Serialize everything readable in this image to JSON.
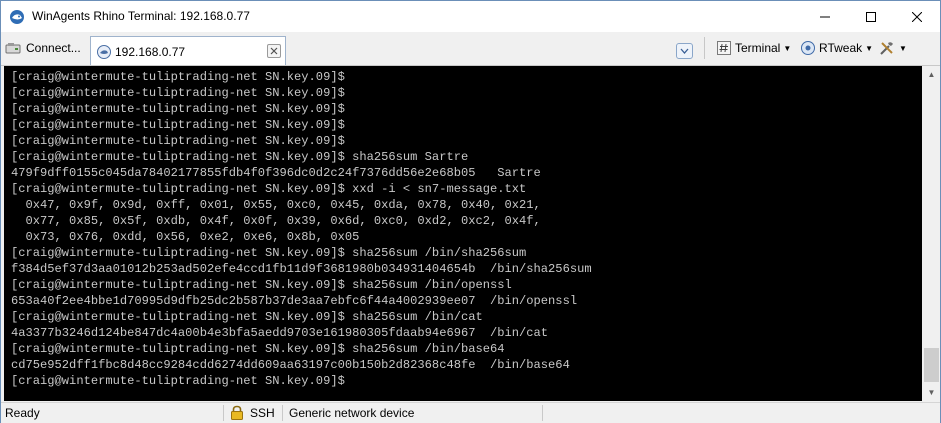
{
  "window": {
    "title": "WinAgents Rhino Terminal: 192.168.0.77",
    "app_icon": "rhino-terminal-icon",
    "controls": [
      "minimize-icon",
      "maximize-icon",
      "close-icon"
    ]
  },
  "toolbar": {
    "connect_label": "Connect...",
    "tab_label": "192.168.0.77",
    "terminal_label": "Terminal",
    "rtweak_label": "RTweak",
    "tools_icon": "tools-icon"
  },
  "terminal": {
    "lines": [
      "[craig@wintermute-tuliptrading-net SN.key.09]$",
      "[craig@wintermute-tuliptrading-net SN.key.09]$",
      "[craig@wintermute-tuliptrading-net SN.key.09]$",
      "[craig@wintermute-tuliptrading-net SN.key.09]$",
      "[craig@wintermute-tuliptrading-net SN.key.09]$",
      "[craig@wintermute-tuliptrading-net SN.key.09]$ sha256sum Sartre",
      "479f9dff0155c045da78402177855fdb4f0f396dc0d2c24f7376dd56e2e68b05   Sartre",
      "[craig@wintermute-tuliptrading-net SN.key.09]$ xxd -i < sn7-message.txt",
      "  0x47, 0x9f, 0x9d, 0xff, 0x01, 0x55, 0xc0, 0x45, 0xda, 0x78, 0x40, 0x21,",
      "  0x77, 0x85, 0x5f, 0xdb, 0x4f, 0x0f, 0x39, 0x6d, 0xc0, 0xd2, 0xc2, 0x4f,",
      "  0x73, 0x76, 0xdd, 0x56, 0xe2, 0xe6, 0x8b, 0x05",
      "[craig@wintermute-tuliptrading-net SN.key.09]$ sha256sum /bin/sha256sum",
      "f384d5ef37d3aa01012b253ad502efe4ccd1fb11d9f3681980b034931404654b  /bin/sha256sum",
      "[craig@wintermute-tuliptrading-net SN.key.09]$ sha256sum /bin/openssl",
      "653a40f2ee4bbe1d70995d9dfb25dc2b587b37de3aa7ebfc6f44a4002939ee07  /bin/openssl",
      "[craig@wintermute-tuliptrading-net SN.key.09]$ sha256sum /bin/cat",
      "4a3377b3246d124be847dc4a00b4e3bfa5aedd9703e161980305fdaab94e6967  /bin/cat",
      "[craig@wintermute-tuliptrading-net SN.key.09]$ sha256sum /bin/base64",
      "cd75e952dff1fbc8d48cc9284cdd6274dd609aa63197c00b150b2d82368c48fe  /bin/base64",
      "[craig@wintermute-tuliptrading-net SN.key.09]$"
    ]
  },
  "statusbar": {
    "state": "Ready",
    "protocol": "SSH",
    "device": "Generic network device"
  },
  "colors": {
    "terminal_bg": "#000000",
    "terminal_fg": "#c8c8c8",
    "chrome_bg": "#f0f0f0"
  }
}
